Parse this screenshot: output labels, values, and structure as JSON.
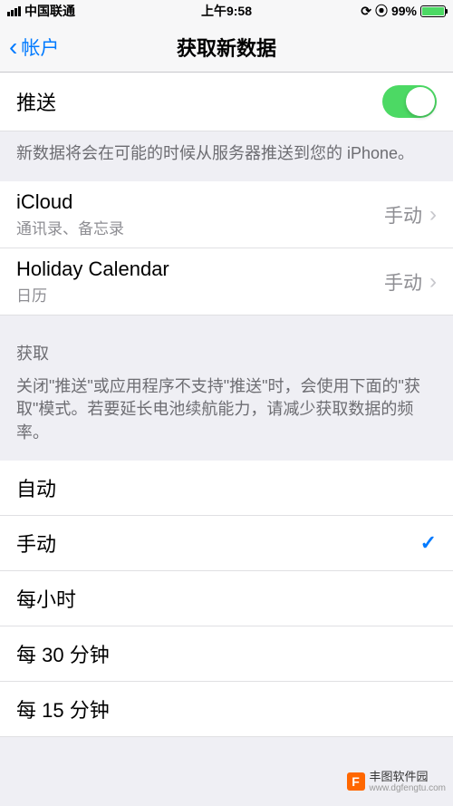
{
  "status_bar": {
    "carrier": "中国联通",
    "time": "上午9:58",
    "lock_icon": "⊙",
    "alarm_icon": "⏰",
    "battery_pct": "99%"
  },
  "nav": {
    "back_label": "帐户",
    "title": "获取新数据"
  },
  "push": {
    "label": "推送",
    "enabled": true,
    "footer": "新数据将会在可能的时候从服务器推送到您的 iPhone。"
  },
  "accounts": [
    {
      "title": "iCloud",
      "subtitle": "通讯录、备忘录",
      "value": "手动"
    },
    {
      "title": "Holiday Calendar",
      "subtitle": "日历",
      "value": "手动"
    }
  ],
  "fetch": {
    "header": "获取",
    "description": "关闭\"推送\"或应用程序不支持\"推送\"时，会使用下面的\"获取\"模式。若要延长电池续航能力，请减少获取数据的频率。",
    "options": [
      {
        "label": "自动",
        "selected": false
      },
      {
        "label": "手动",
        "selected": true
      },
      {
        "label": "每小时",
        "selected": false
      },
      {
        "label": "每 30 分钟",
        "selected": false
      },
      {
        "label": "每 15 分钟",
        "selected": false
      }
    ]
  },
  "watermark": {
    "title": "丰图软件园",
    "url": "www.dgfengtu.com"
  }
}
